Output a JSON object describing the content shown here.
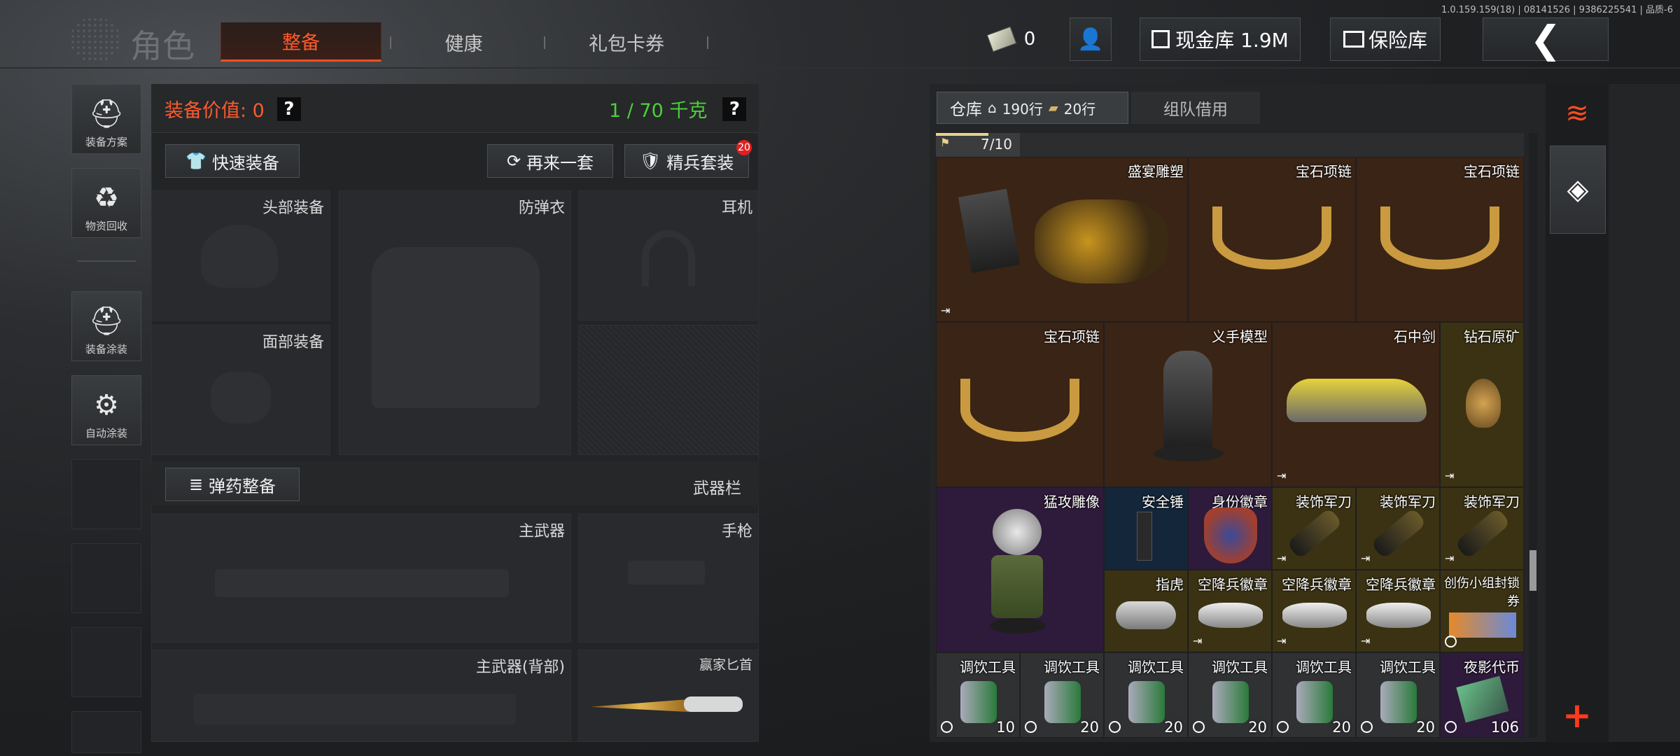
{
  "version_info": "1.0.159.159(18) | 08141526 | 9386225541 | 品质-6",
  "header": {
    "title": "角色",
    "tabs": [
      {
        "label": "整备",
        "active": true
      },
      {
        "label": "健康"
      },
      {
        "label": "礼包卡券"
      }
    ],
    "money_count": "0",
    "cash_vault": "现金库 1.9M",
    "safe_vault": "保险库"
  },
  "sidebar": {
    "items": [
      {
        "label": "装备方案",
        "icon": "helmet-grid-icon"
      },
      {
        "label": "物资回收",
        "icon": "recycle-icon"
      },
      {
        "label": "装备涂装",
        "icon": "helmet-brush-icon"
      },
      {
        "label": "自动涂装",
        "icon": "brush-gear-icon"
      }
    ]
  },
  "equipment": {
    "value_label": "装备价值: 0",
    "weight": "1 / 70 千克",
    "quick_equip": "快速装备",
    "again": "再来一套",
    "elite_set": "精兵套装",
    "elite_badge": "20",
    "ammo": "弹药整备",
    "weapon_bar": "武器栏",
    "slots": {
      "head": "头部装备",
      "vest": "防弹衣",
      "earphone": "耳机",
      "face": "面部装备",
      "primary": "主武器",
      "pistol": "手枪",
      "primary_back": "主武器(背部)",
      "knife": "赢家匕首"
    }
  },
  "storage": {
    "tab_label": "仓库",
    "rows_house": "190行",
    "rows_ticket": "20行",
    "team_borrow": "组队借用",
    "capacity": "7/10",
    "items": [
      {
        "name": "盛宴雕塑"
      },
      {
        "name": "宝石项链"
      },
      {
        "name": "宝石项链"
      },
      {
        "name": "宝石项链"
      },
      {
        "name": "义手模型"
      },
      {
        "name": "石中剑"
      },
      {
        "name": "钻石原矿"
      },
      {
        "name": "猛攻雕像"
      },
      {
        "name": "安全锤"
      },
      {
        "name": "身份徽章"
      },
      {
        "name": "装饰军刀"
      },
      {
        "name": "装饰军刀"
      },
      {
        "name": "装饰军刀"
      },
      {
        "name": "指虎"
      },
      {
        "name": "空降兵徽章"
      },
      {
        "name": "空降兵徽章"
      },
      {
        "name": "空降兵徽章"
      },
      {
        "name": "创伤小组封锁券"
      },
      {
        "name": "调饮工具",
        "count": "10"
      },
      {
        "name": "调饮工具",
        "count": "20"
      },
      {
        "name": "调饮工具",
        "count": "20"
      },
      {
        "name": "调饮工具",
        "count": "20"
      },
      {
        "name": "调饮工具",
        "count": "20"
      },
      {
        "name": "调饮工具",
        "count": "20"
      },
      {
        "name": "夜影代币",
        "count": "106"
      }
    ]
  },
  "colors": {
    "accent": "#ff4e1f",
    "green": "#4cd03a",
    "brown": "#3a2415",
    "purple": "#2e1a3a",
    "olive": "#3a3213"
  }
}
